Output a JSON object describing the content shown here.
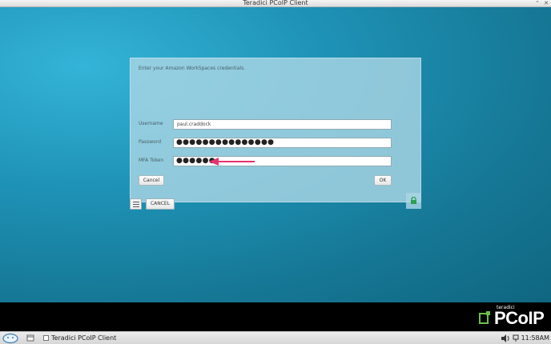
{
  "window": {
    "title": "Teradici PCoIP Client",
    "controls": [
      "⌃",
      "✕"
    ]
  },
  "dialog": {
    "instruction": "Enter your Amazon WorkSpaces credentials.",
    "username_label": "Username",
    "username_value": "paul.craddock",
    "password_label": "Password",
    "password_value": "●●●●●●●●●●●●●●●",
    "mfa_label": "MFA Token",
    "mfa_value": "●●●●●●",
    "cancel_label": "Cancel",
    "ok_label": "OK"
  },
  "toolbar": {
    "cancel_label": "CANCEL"
  },
  "brand": {
    "small": "teradici",
    "big": "PCoIP"
  },
  "taskbar": {
    "task_label": "Teradici PCoIP Client",
    "clock": "11:58AM"
  },
  "colors": {
    "desktop": "#1f94b8",
    "arrow": "#e8326e",
    "lock": "#2e9e4f",
    "brand_accent": "#6cc04a"
  }
}
